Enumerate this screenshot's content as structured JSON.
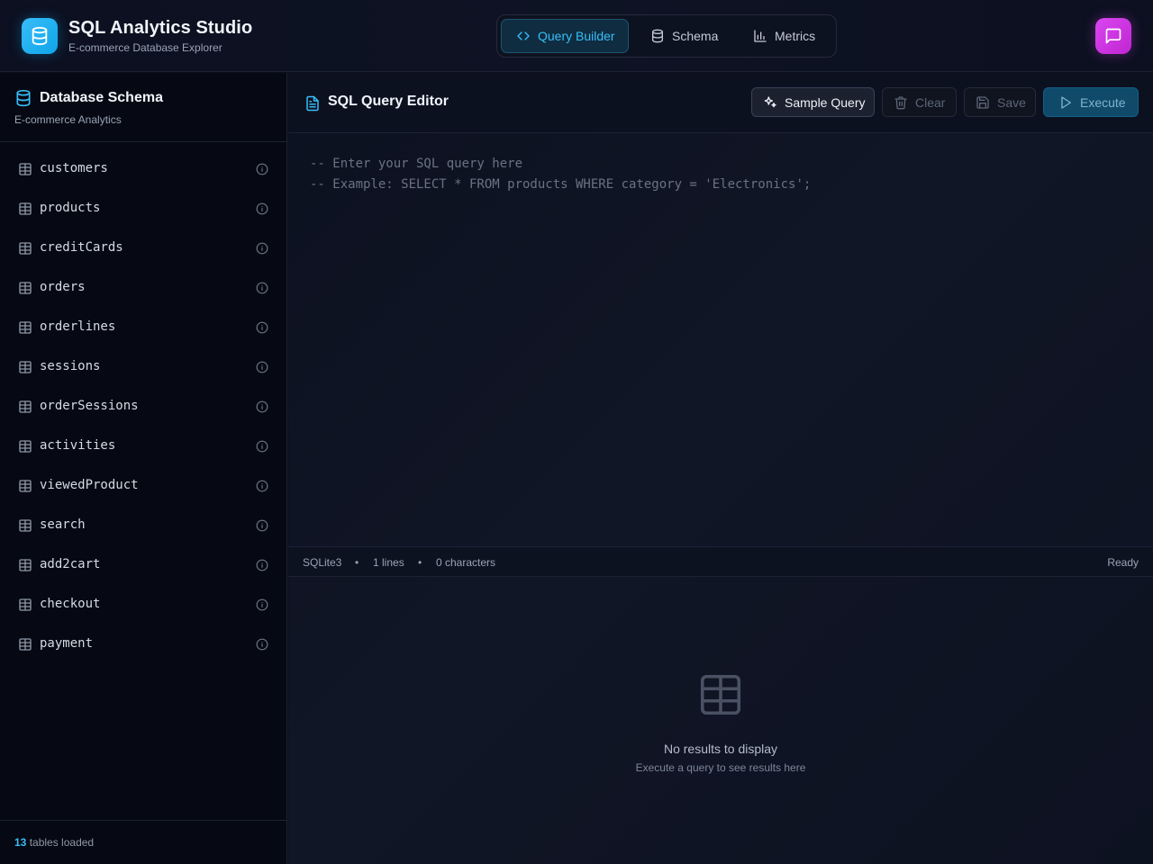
{
  "app": {
    "title": "SQL Analytics Studio",
    "subtitle": "E-commerce Database Explorer"
  },
  "nav": {
    "tabs": [
      {
        "label": "Query Builder",
        "icon": "code-icon",
        "active": true
      },
      {
        "label": "Schema",
        "icon": "database-icon",
        "active": false
      },
      {
        "label": "Metrics",
        "icon": "bar-chart-icon",
        "active": false
      }
    ]
  },
  "sidebar": {
    "title": "Database Schema",
    "subtitle": "E-commerce Analytics",
    "tables": [
      "customers",
      "products",
      "creditCards",
      "orders",
      "orderlines",
      "sessions",
      "orderSessions",
      "activities",
      "viewedProduct",
      "search",
      "add2cart",
      "checkout",
      "payment"
    ],
    "footer": {
      "count": "13",
      "label": "tables loaded"
    }
  },
  "editor": {
    "title": "SQL Query Editor",
    "buttons": {
      "sample": "Sample Query",
      "clear": "Clear",
      "save": "Save",
      "execute": "Execute"
    },
    "placeholder_lines": [
      "-- Enter your SQL query here",
      "-- Example: SELECT * FROM products WHERE category = 'Electronics';"
    ]
  },
  "status": {
    "engine": "SQLite3",
    "lines": "1 lines",
    "characters": "0 characters",
    "state": "Ready",
    "separator": "•"
  },
  "results": {
    "empty_title": "No results to display",
    "empty_subtitle": "Execute a query to see results here"
  },
  "colors": {
    "accent": "#38bdf8",
    "chat_button": "#d946ef",
    "background": "#0b0f1c"
  }
}
